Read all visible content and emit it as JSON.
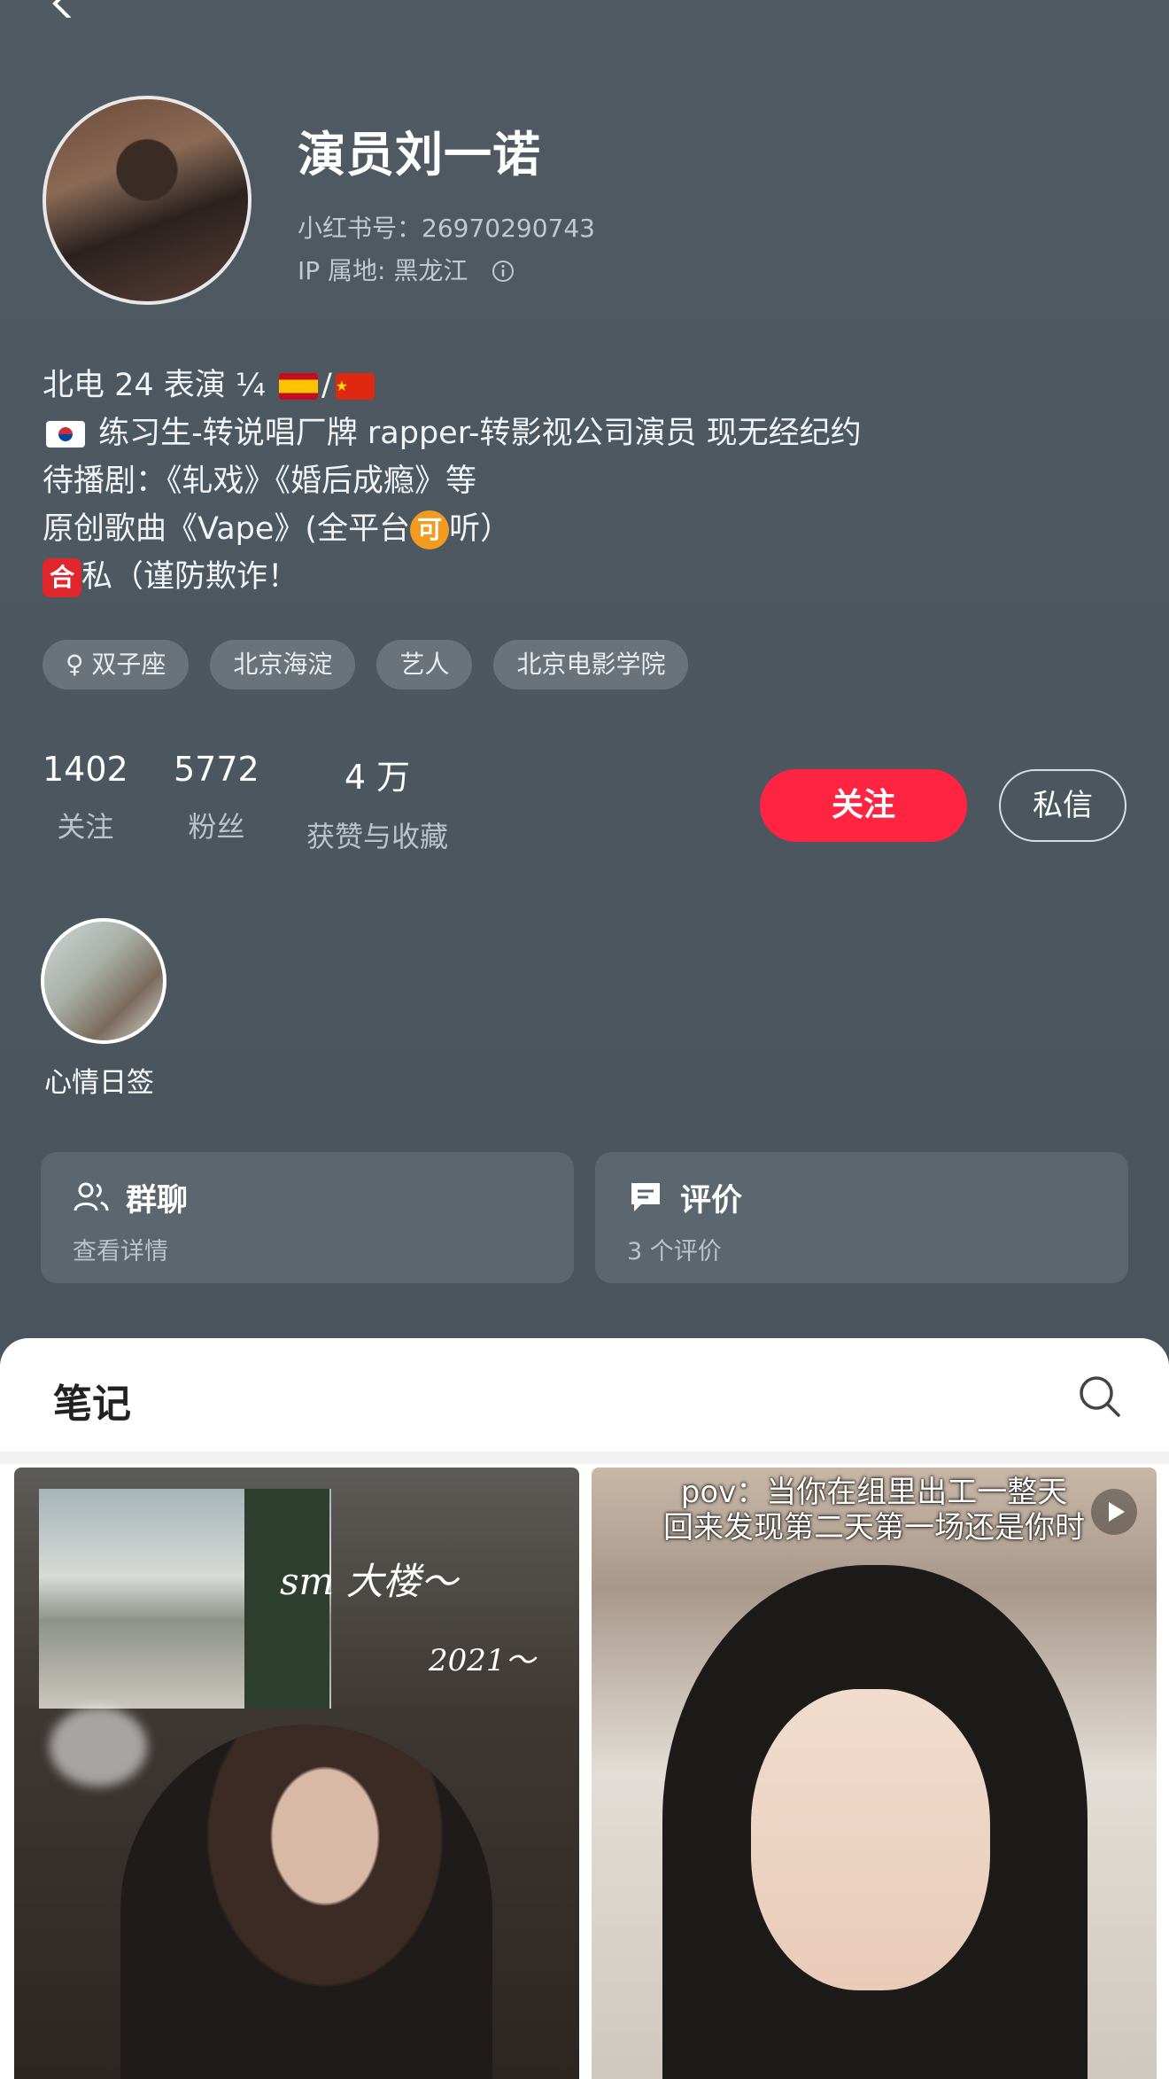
{
  "profile": {
    "name": "演员刘一诺",
    "red_id": "小红书号：26970290743",
    "ip_location": "IP 属地: 黑龙江",
    "bio": [
      "北电 24 表演  ¼",
      "练习生-转说唱厂牌 rapper-转影视公司演员  现无经纪约",
      "待播剧：《轧戏》《婚后成瘾》等",
      "原创歌曲《Vape》(全平台",
      "听）",
      "私（谨防欺诈！"
    ],
    "badges": {
      "ke": "可",
      "he": "合"
    },
    "tags": [
      "♀ 双子座",
      "北京海淀",
      "艺人",
      "北京电影学院"
    ]
  },
  "stats": [
    {
      "value": "1402",
      "label": "关注"
    },
    {
      "value": "5772",
      "label": "粉丝"
    },
    {
      "value": "4 万",
      "label": "获赞与收藏"
    }
  ],
  "buttons": {
    "follow": "关注",
    "message": "私信"
  },
  "highlight": {
    "label": "心情日签"
  },
  "cards": [
    {
      "title": "群聊",
      "subtitle": "查看详情",
      "icon": "group-icon"
    },
    {
      "title": "评价",
      "subtitle": "3 个评价",
      "icon": "comment-icon"
    }
  ],
  "notes": {
    "tab_title": "笔记",
    "items": [
      {
        "overlay_text": [
          "sm 大楼～",
          "2021～"
        ]
      },
      {
        "caption": [
          "pov：当你在组里出工一整天",
          "回来发现第二天第一场还是你时"
        ],
        "type": "video"
      }
    ]
  },
  "colors": {
    "accent": "#ff2442",
    "background": "#4f5961",
    "card": "#5c666e",
    "tag": "#6a737a"
  }
}
